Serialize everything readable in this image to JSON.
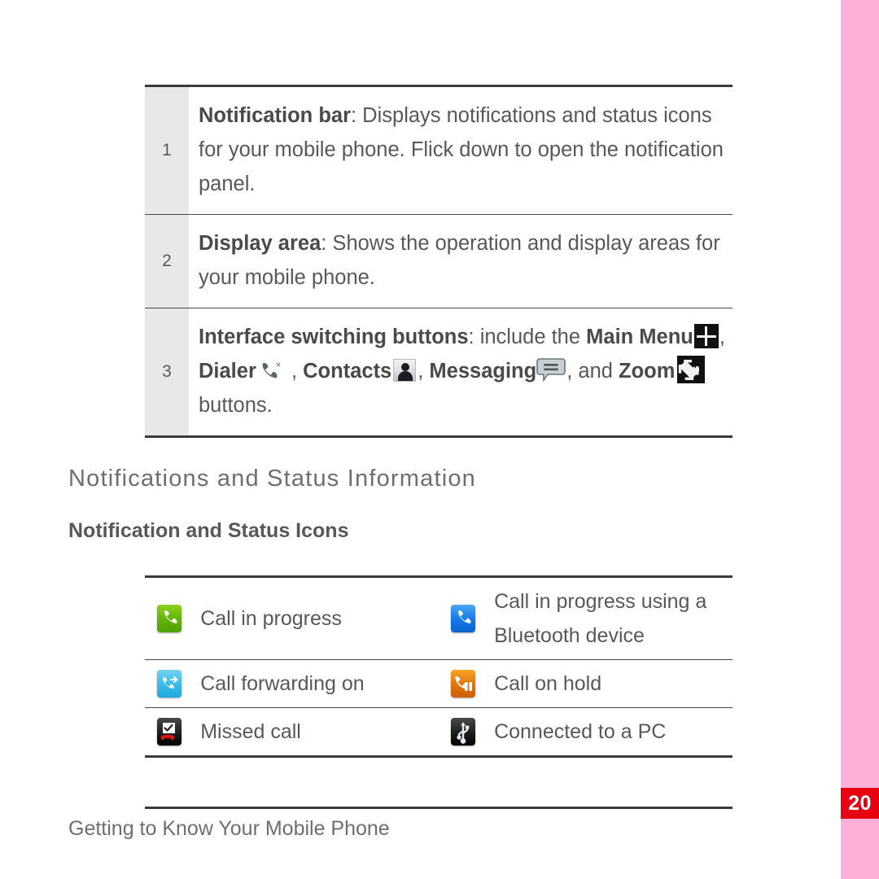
{
  "page": {
    "number": "20",
    "footer": "Getting to Know Your Mobile Phone",
    "accent_pink": "#ffb0d8",
    "accent_red": "#e60012",
    "text_gray": "#58585a"
  },
  "parts_table": {
    "rows": [
      {
        "number": "1",
        "bold": "Notification bar",
        "rest": ": Displays notifications and status icons for your mobile phone. Flick down to open the notification panel."
      },
      {
        "number": "2",
        "bold": "Display area",
        "rest": ": Shows the operation and display areas for your mobile phone."
      },
      {
        "number": "3",
        "lead_bold": "Interface switching buttons",
        "seg_1": ": include the ",
        "b_main_menu": "Main Menu",
        "seg_2": ", ",
        "b_dialer": "Dialer",
        "seg_3": " , ",
        "b_contacts": "Contacts",
        "seg_4": ", ",
        "b_messaging": "Messaging",
        "seg_5": ", and ",
        "b_zoom": "Zoom",
        "seg_6": " buttons.",
        "icons": {
          "main_menu": "main-menu-grid-icon",
          "dialer": "dialer-handset-icon",
          "contacts": "contacts-person-icon",
          "messaging": "messaging-bubble-icon",
          "zoom": "zoom-arrow-icon"
        }
      }
    ]
  },
  "headings": {
    "section": "Notifications and Status Information",
    "subsection": "Notification and Status Icons"
  },
  "status_icons_table": {
    "rows": [
      {
        "left": {
          "icon": "call-in-progress-icon",
          "color": "#63b50c",
          "label": "Call in progress"
        },
        "right": {
          "icon": "call-in-progress-bluetooth-icon",
          "color": "#1478e8",
          "label": "Call in progress using a Bluetooth device"
        }
      },
      {
        "left": {
          "icon": "call-forwarding-icon",
          "color": "#38bbe8",
          "label": "Call forwarding on"
        },
        "right": {
          "icon": "call-on-hold-icon",
          "color": "#e2720c",
          "label": "Call on hold"
        }
      },
      {
        "left": {
          "icon": "missed-call-icon",
          "color": "#1d1d1d",
          "label": "Missed call"
        },
        "right": {
          "icon": "usb-connected-icon",
          "color": "#1d1d1d",
          "label": "Connected to a PC"
        }
      }
    ]
  }
}
